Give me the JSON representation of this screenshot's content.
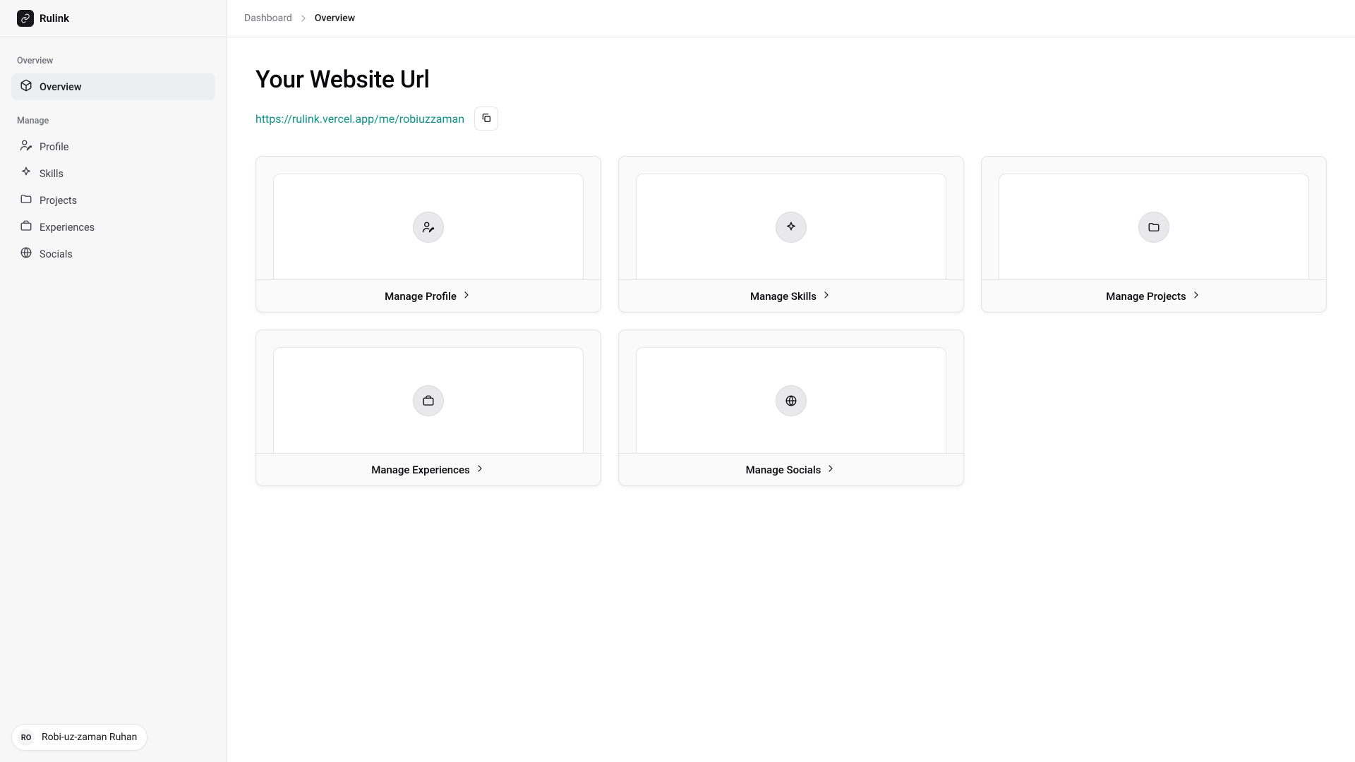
{
  "brand": "Rulink",
  "sidebar": {
    "section1_label": "Overview",
    "section2_label": "Manage",
    "overview": "Overview",
    "profile": "Profile",
    "skills": "Skills",
    "projects": "Projects",
    "experiences": "Experiences",
    "socials": "Socials"
  },
  "user": {
    "initials": "RO",
    "name": "Robi-uz-zaman Ruhan"
  },
  "breadcrumb": {
    "root": "Dashboard",
    "current": "Overview"
  },
  "page": {
    "title": "Your Website Url",
    "url": "https://rulink.vercel.app/me/robiuzzaman"
  },
  "cards": {
    "profile": "Manage Profile",
    "skills": "Manage Skills",
    "projects": "Manage Projects",
    "experiences": "Manage Experiences",
    "socials": "Manage Socials"
  }
}
